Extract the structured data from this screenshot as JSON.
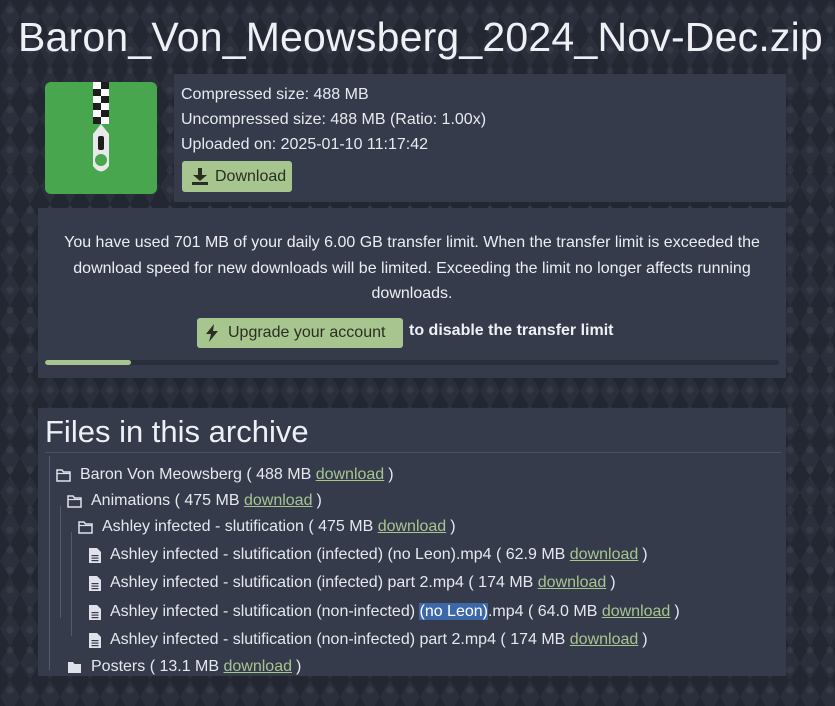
{
  "title": "Baron_Von_Meowsberg_2024_Nov-Dec.zip",
  "file_info": {
    "compressed": "Compressed size: 488 MB",
    "uncompressed": "Uncompressed size: 488 MB (Ratio: 1.00x)",
    "uploaded": "Uploaded on: 2025-01-10 11:17:42",
    "download_label": "Download",
    "icon": "zip-file-icon",
    "icon_color": "#48a64f"
  },
  "limit": {
    "message": "You have used 701 MB of your daily 6.00 GB transfer limit. When the transfer limit is exceeded the download speed for new downloads will be limited. Exceeding the limit no longer affects running downloads.",
    "upgrade_label": "Upgrade your account",
    "upgrade_suffix": "to disable the transfer limit",
    "progress": 0.117,
    "accent": "#a7c58f"
  },
  "files": {
    "heading": "Files in this archive",
    "download_word": "download",
    "tree": [
      {
        "type": "folder",
        "open": true,
        "level": 0,
        "name": "Baron Von Meowsberg",
        "size": "488 MB"
      },
      {
        "type": "folder",
        "open": true,
        "level": 1,
        "name": "Animations",
        "size": "475 MB"
      },
      {
        "type": "folder",
        "open": true,
        "level": 2,
        "name": "Ashley infected - slutification",
        "size": "475 MB"
      },
      {
        "type": "file",
        "level": 3,
        "name": "Ashley infected - slutification (infected) (no Leon).mp4",
        "size": "62.9 MB"
      },
      {
        "type": "file",
        "level": 3,
        "name": "Ashley infected - slutification (infected) part 2.mp4",
        "size": "174 MB"
      },
      {
        "type": "file",
        "level": 3,
        "name": "Ashley infected - slutification (non-infected) (no Leon).mp4",
        "size": "64.0 MB",
        "highlight": "(no Leon)"
      },
      {
        "type": "file",
        "level": 3,
        "name": "Ashley infected - slutification (non-infected) part 2.mp4",
        "size": "174 MB"
      },
      {
        "type": "folder",
        "open": false,
        "level": 1,
        "name": "Posters",
        "size": "13.1 MB"
      }
    ]
  }
}
